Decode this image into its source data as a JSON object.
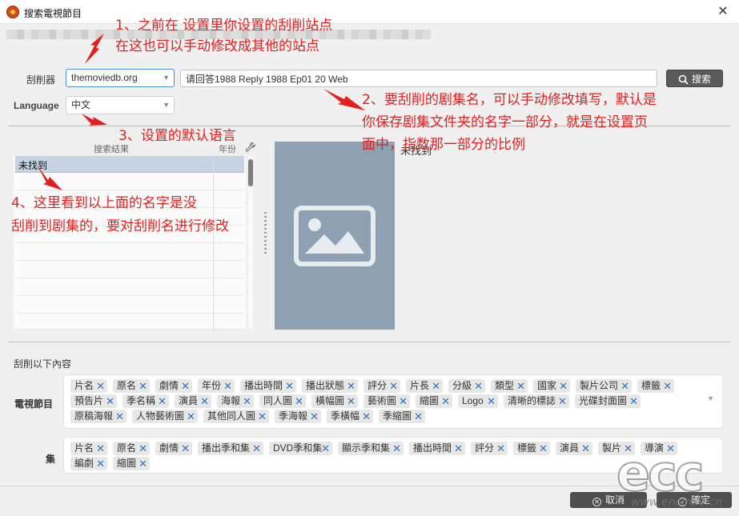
{
  "window": {
    "title": "搜索電視節目",
    "close": "✕"
  },
  "scraper": {
    "label": "刮削器",
    "value": "themoviedb.org"
  },
  "search": {
    "value": "请回答1988 Reply 1988 Ep01 20 Web",
    "button": "搜索"
  },
  "language": {
    "label": "Language",
    "value": "中文"
  },
  "results": {
    "col_title": "搜索結果",
    "col_year": "年份",
    "rows": [
      {
        "title": "未找到"
      }
    ]
  },
  "preview": {
    "title": "未找到"
  },
  "scrape_section": {
    "title": "刮削以下內容",
    "tv_label": "電視節目",
    "tv_tags": [
      "片名",
      "原名",
      "劇情",
      "年份",
      "播出時間",
      "播出狀態",
      "評分",
      "片長",
      "分級",
      "類型",
      "國家",
      "製片公司",
      "標籤",
      "預告片",
      "季名稱",
      "演員",
      "海報",
      "同人圖",
      "橫幅圖",
      "藝術圖",
      "縮圖",
      "Logo",
      "清晰的標誌",
      "光碟封面圖",
      "原稿海報",
      "人物藝術圖",
      "其他同人圖",
      "季海報",
      "季橫幅",
      "季縮圖"
    ],
    "ep_label": "集",
    "ep_tags": [
      "片名",
      "原名",
      "劇情",
      "播出季和集",
      "DVD季和集",
      "顯示季和集",
      "播出時間",
      "評分",
      "標籤",
      "演員",
      "製片",
      "導演",
      "編劇",
      "縮圖"
    ]
  },
  "footer": {
    "cancel": "取消",
    "ok": "確定"
  },
  "annotations": {
    "a1_line1": "1、之前在 设置里你设置的刮削站点",
    "a1_line2": "在这也可以手动修改成其他的站点",
    "a2_line1": "2、要刮削的剧集名，可以手动修改填写，默认是",
    "a2_line2": "你保存剧集文件夹的名字一部分，就是在设置页",
    "a2_line3": "面中，指数那一部分的比例",
    "a3": "3、设置的默认语言",
    "a4_line1": "4、这里看到以上面的名字是没",
    "a4_line2": "刮削到剧集的，要对刮削名进行修改"
  },
  "watermark": {
    "logo": "ecc",
    "url": "www.encircle.cn"
  },
  "colors": {
    "annotation": "#e21f1f",
    "tag_remove": "#2f72c8",
    "poster_bg": "#8da1b3"
  }
}
